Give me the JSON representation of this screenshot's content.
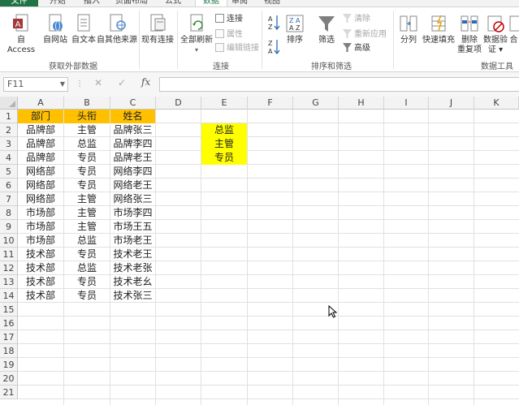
{
  "ribbon_tabs": [
    {
      "label": "文件"
    },
    {
      "label": "开始"
    },
    {
      "label": "插入"
    },
    {
      "label": "页面布局"
    },
    {
      "label": "公式"
    },
    {
      "label": "数据",
      "active": true
    },
    {
      "label": "审阅"
    },
    {
      "label": "视图"
    }
  ],
  "ribbon": {
    "get_external": {
      "buttons": [
        "自 Access",
        "自网站",
        "自文本",
        "自其他来源"
      ],
      "label": "获取外部数据"
    },
    "existing_connections": "现有连接",
    "connections": {
      "refresh_all": "全部刷新",
      "connect": "连接",
      "properties": "属性",
      "edit_links": "编辑链接",
      "label": "连接"
    },
    "sort_filter": {
      "sort": "排序",
      "filter": "筛选",
      "clear": "清除",
      "reapply": "重新应用",
      "advanced": "高级",
      "label": "排序和筛选"
    },
    "data_tools": {
      "text_to_columns": "分列",
      "flash_fill": "快速填充",
      "remove_dup_1": "删除",
      "remove_dup_2": "重复项",
      "validation_1": "数据验",
      "validation_2": "证 ▾",
      "consolidate": "合",
      "label": "数据工具"
    }
  },
  "formula_bar": {
    "name_box": "F11",
    "fx": "fx",
    "formula": ""
  },
  "columns": [
    "A",
    "B",
    "C",
    "D",
    "E",
    "F",
    "G",
    "H",
    "I",
    "J",
    "K"
  ],
  "rows": [
    "1",
    "2",
    "3",
    "4",
    "5",
    "6",
    "7",
    "8",
    "9",
    "10",
    "11",
    "12",
    "13",
    "14",
    "15",
    "16",
    "17",
    "18",
    "19",
    "20",
    "21"
  ],
  "table": {
    "headers": [
      "部门",
      "头衔",
      "姓名"
    ],
    "rows": [
      [
        "品牌部",
        "主管",
        "品牌张三"
      ],
      [
        "品牌部",
        "总监",
        "品牌李四"
      ],
      [
        "品牌部",
        "专员",
        "品牌老王"
      ],
      [
        "网络部",
        "专员",
        "网络李四"
      ],
      [
        "网络部",
        "专员",
        "网络老王"
      ],
      [
        "网络部",
        "主管",
        "网络张三"
      ],
      [
        "市场部",
        "主管",
        "市场李四"
      ],
      [
        "市场部",
        "主管",
        "市场王五"
      ],
      [
        "市场部",
        "总监",
        "市场老王"
      ],
      [
        "技术部",
        "专员",
        "技术老王"
      ],
      [
        "技术部",
        "总监",
        "技术老张"
      ],
      [
        "技术部",
        "专员",
        "技术老幺"
      ],
      [
        "技术部",
        "专员",
        "技术张三"
      ]
    ]
  },
  "title_list": [
    "总监",
    "主管",
    "专员"
  ],
  "colors": {
    "header_fill": "#ffc000",
    "highlight_fill": "#ffff00",
    "file_tab": "#217346"
  }
}
